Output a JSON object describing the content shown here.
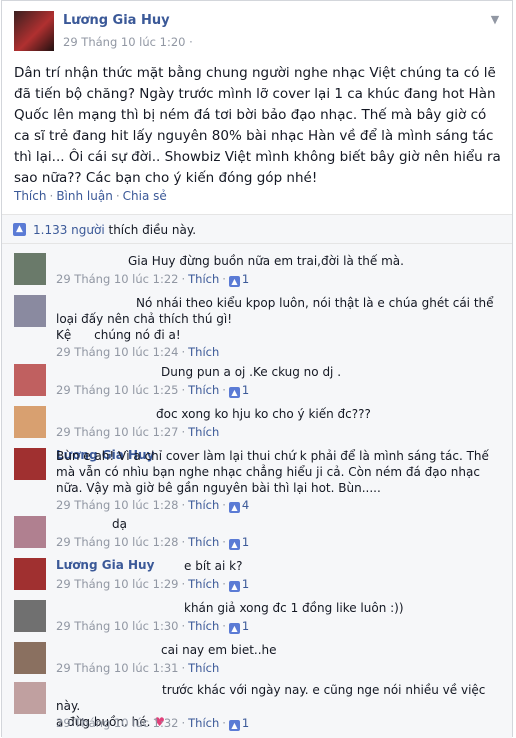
{
  "post": {
    "author": "Lương Gia Huy",
    "time": "29 Tháng 10 lúc 1:20",
    "globe": "·",
    "text": "Dân trí nhận thức mặt bằng chung người nghe nhạc Việt chúng ta có lẽ đã tiến bộ chăng? Ngày trước mình lỡ cover lại 1 ca khúc đang hot Hàn Quốc lên mạng thì bị ném đá tơi bời bảo đạo nhạc. Thế mà bây giờ có ca sĩ trẻ đang hit lấy nguyên 80% bài nhạc Hàn về để là mình sáng tác thì lại... Ôi cái sự đời.. Showbiz Việt mình không biết bây giờ nên hiểu ra sao nữa?? Các bạn cho ý kiến đóng góp nhé!",
    "actions": {
      "like": "Thích",
      "comment": "Bình luận",
      "share": "Chia sẻ"
    }
  },
  "likes": {
    "count": "1.133 người",
    "suffix": "thích điều này."
  },
  "comments": [
    {
      "name": "",
      "text": "Gia Huy đừng buồn nữa em trai,đời là thế mà.",
      "time": "29 Tháng 10 lúc 1:22",
      "like": "Thích",
      "likes": "1",
      "avatar": "#6a7a6a"
    },
    {
      "name": "",
      "text": "Nó nhái theo kiểu kpop luôn, nói thật là e chúa ghét cái thể loại đấy nên chả thích thú gì!\nKệ      chúng nó đi a!",
      "time": "29 Tháng 10 lúc 1:24",
      "like": "Thích",
      "likes": "",
      "avatar": "#8a8aa0"
    },
    {
      "name": "",
      "text": "Dung pun a oj .Ke ckug no dj .",
      "time": "29 Tháng 10 lúc 1:25",
      "like": "Thích",
      "likes": "1",
      "avatar": "#c06060"
    },
    {
      "name": "",
      "text": "đoc xong ko hju ko cho ý kiến đc???",
      "time": "29 Tháng 10 lúc 1:27",
      "like": "Thích",
      "likes": "",
      "avatar": "#d8a070"
    },
    {
      "name": "Lương Gia Huy",
      "text": "Bùn e ah! Vì a chỉ cover làm lại thui chứ k phải để là mình sáng tác. Thế mà vẫn có nhìu bạn nghe nhạc chẳng hiểu ji cả. Còn ném đá đạo nhạc nữa. Vậy mà giờ bê gần nguyên bài thì lại hot. Bùn.....",
      "time": "29 Tháng 10 lúc 1:28",
      "like": "Thích",
      "likes": "4",
      "avatar": "#a03030"
    },
    {
      "name": "",
      "text": "dạ",
      "time": "29 Tháng 10 lúc 1:28",
      "like": "Thích",
      "likes": "1",
      "avatar": "#b08090"
    },
    {
      "name": "Lương Gia Huy",
      "text": "e bít ai k?",
      "time": "29 Tháng 10 lúc 1:29",
      "like": "Thích",
      "likes": "1",
      "avatar": "#a03030"
    },
    {
      "name": "",
      "text": "khán giả xong đc 1 đồng like luôn :))",
      "time": "29 Tháng 10 lúc 1:30",
      "like": "Thích",
      "likes": "1",
      "avatar": "#707070"
    },
    {
      "name": "",
      "text": "cai nay em biet..he",
      "time": "29 Tháng 10 lúc 1:31",
      "like": "Thích",
      "likes": "",
      "avatar": "#8a7060"
    },
    {
      "name": "",
      "text": "trước khác với ngày nay. e cũng nge nói nhiều về việc này.\na đừg buồn. hé.",
      "time": "29 Tháng 10 lúc 1:32",
      "like": "Thích",
      "likes": "1",
      "avatar": "#c0a0a0"
    }
  ]
}
